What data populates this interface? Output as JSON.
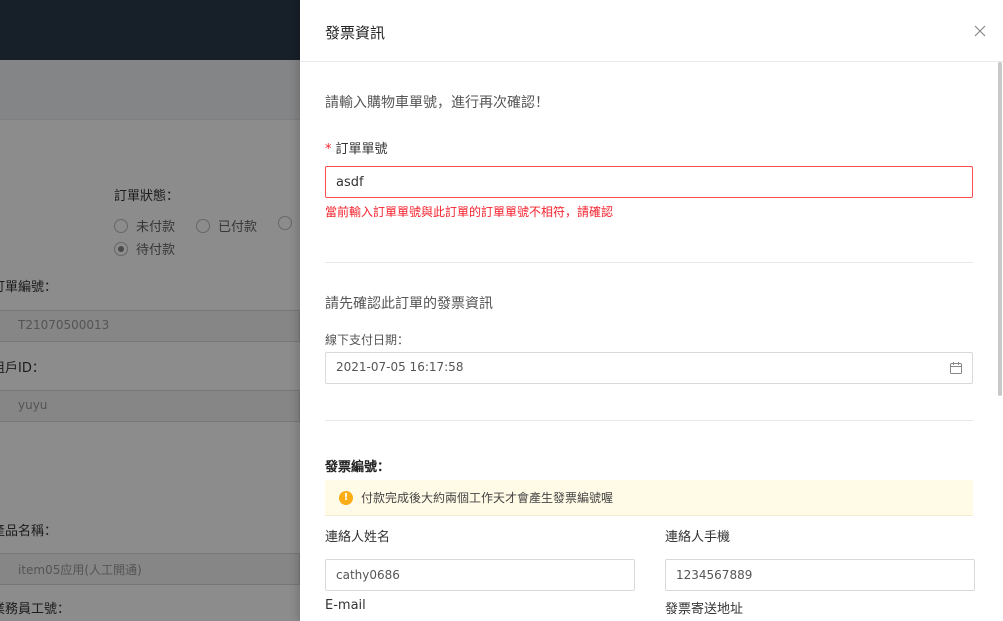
{
  "background": {
    "order_status_label": "訂單狀態：",
    "status_options": [
      {
        "label": "未付款",
        "selected": false
      },
      {
        "label": "已付款",
        "selected": false
      },
      {
        "label": "待付款",
        "selected": true
      }
    ],
    "order_no_label": "訂單編號：",
    "order_no_value": "T21070500013",
    "tenant_label": "租戶ID：",
    "tenant_value": "yuyu",
    "product_label": "產品名稱：",
    "product_value": "item05应用(人工開通)",
    "staff_label": "業務員工號："
  },
  "drawer": {
    "title": "發票資訊",
    "close_icon": "close-icon",
    "prompt": "請輸入購物車單號，進行再次確認！",
    "order_field": {
      "required_mark": "*",
      "label": "訂單單號",
      "value": "asdf",
      "error": "當前輸入訂單單號與此訂單的訂單單號不相符，請確認"
    },
    "confirm_section": {
      "title": "請先確認此訂單的發票資訊",
      "date_label": "線下支付日期：",
      "date_value": "2021-07-05 16:17:58",
      "date_icon": "calendar-icon"
    },
    "invoice": {
      "title": "發票編號：",
      "alert_icon": "info-icon",
      "alert_text": "付款完成後大約兩個工作天才會產生發票編號喔",
      "contact_name_label": "連絡人姓名",
      "contact_name_value": "cathy0686",
      "contact_phone_label": "連絡人手機",
      "contact_phone_value": "1234567889",
      "email_label": "E-mail",
      "address_label": "發票寄送地址"
    }
  },
  "colors": {
    "error": "#f5222d",
    "alert_bg": "#fffbe6",
    "alert_icon": "#faad14",
    "topbar": "#2b3a4b"
  }
}
